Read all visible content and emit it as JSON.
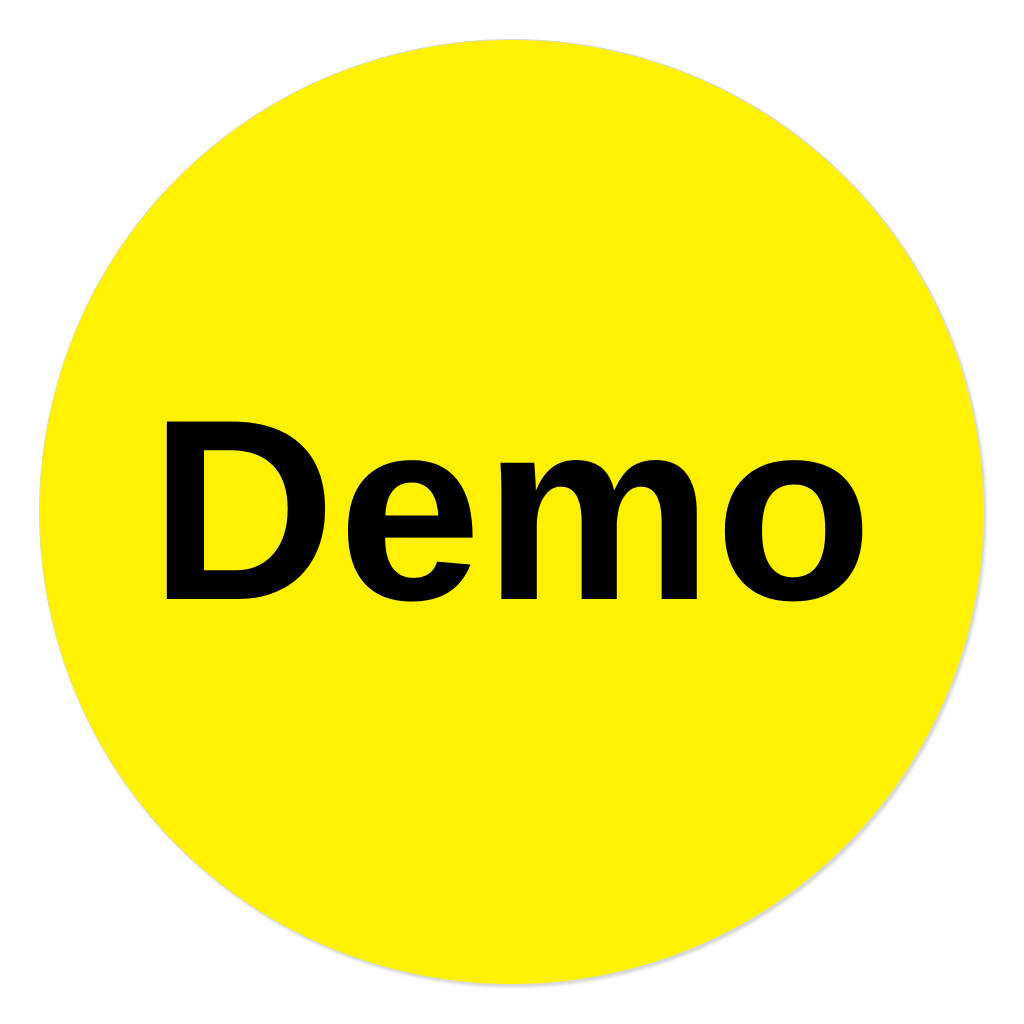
{
  "badge": {
    "label": "Demo",
    "fill_color": "#FFF200",
    "text_color": "#000000",
    "background_color": "#FFFFFF"
  }
}
